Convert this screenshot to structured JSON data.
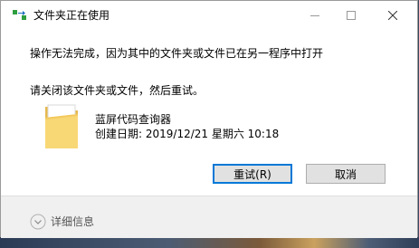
{
  "window": {
    "title": "文件夹正在使用",
    "controls": {
      "minimize": "minimize-icon",
      "maximize": "maximize-icon",
      "close": "close-icon"
    }
  },
  "message": {
    "line1": "操作无法完成，因为其中的文件夹或文件已在另一程序中打开",
    "line2": "请关闭该文件夹或文件，然后重试。"
  },
  "item": {
    "icon": "folder-icon",
    "name": "蓝屏代码查询器",
    "created": "创建日期: 2019/12/21 星期六 10:18"
  },
  "buttons": {
    "retry": "重试(R)",
    "cancel": "取消"
  },
  "footer": {
    "details_label": "详细信息"
  },
  "colors": {
    "accent": "#0078d7",
    "folder": "#f8d775",
    "footer_bg": "#f0f0f0"
  }
}
